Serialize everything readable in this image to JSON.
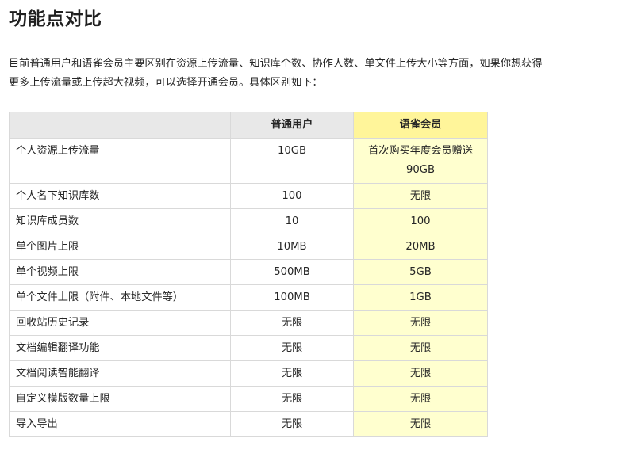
{
  "title": "功能点对比",
  "intro": {
    "line1": "目前普通用户和语雀会员主要区别在资源上传流量、知识库个数、协作人数、单文件上传大小等方面，如果你想获得",
    "line2": "更多上传流量或上传超大视频，可以选择开通会员。具体区别如下："
  },
  "table": {
    "headers": {
      "feature": "",
      "normal": "普通用户",
      "vip": "语雀会员"
    },
    "rows": [
      {
        "feature": "个人资源上传流量",
        "normal": "10GB",
        "vip": "首次购买年度会员赠送90GB"
      },
      {
        "feature": "个人名下知识库数",
        "normal": "100",
        "vip": "无限"
      },
      {
        "feature": "知识库成员数",
        "normal": "10",
        "vip": "100"
      },
      {
        "feature": "单个图片上限",
        "normal": "10MB",
        "vip": "20MB"
      },
      {
        "feature": "单个视频上限",
        "normal": "500MB",
        "vip": "5GB"
      },
      {
        "feature": "单个文件上限（附件、本地文件等）",
        "normal": "100MB",
        "vip": "1GB"
      },
      {
        "feature": "回收站历史记录",
        "normal": "无限",
        "vip": "无限"
      },
      {
        "feature": "文档编辑翻译功能",
        "normal": "无限",
        "vip": "无限"
      },
      {
        "feature": "文档阅读智能翻译",
        "normal": "无限",
        "vip": "无限"
      },
      {
        "feature": "自定义模版数量上限",
        "normal": "无限",
        "vip": "无限"
      },
      {
        "feature": "导入导出",
        "normal": "无限",
        "vip": "无限"
      }
    ]
  },
  "colors": {
    "header_bg": "#e8e8e8",
    "vip_header_bg": "#fff59a",
    "vip_cell_bg": "#ffffcf",
    "border": "#d9d9d9"
  }
}
